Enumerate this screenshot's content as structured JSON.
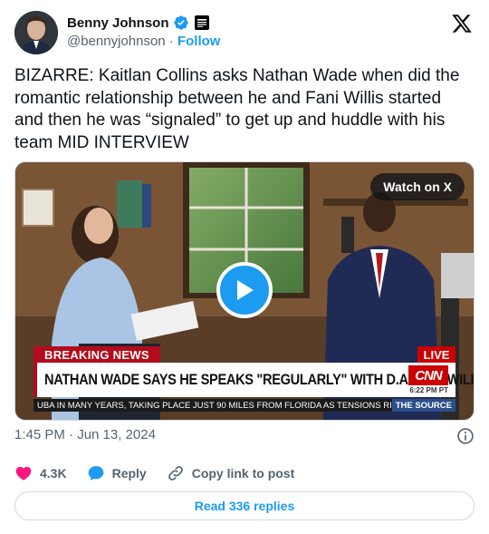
{
  "author": {
    "display_name": "Benny Johnson",
    "handle": "@bennyjohnson",
    "separator": "·",
    "follow_label": "Follow",
    "verified_color": "#1d9bf0",
    "avatar_icon": "person-avatar"
  },
  "tweet": {
    "text": "BIZARRE: Kaitlan Collins asks Nathan Wade when did the romantic relationship between he and Fani Willis started and then he was “signaled” to get up and huddle with his team MID INTERVIEW"
  },
  "media": {
    "watch_label": "Watch on X",
    "breaking_label": "BREAKING NEWS",
    "live_label": "LIVE",
    "headline": "NATHAN WADE SAYS HE SPEAKS \"REGULARLY\" WITH D.A. FANI WILLIS",
    "network_logo": "CNN",
    "network_time": "6:22 PM PT",
    "ticker_text": "UBA IN MANY YEARS, TAKING PLACE JUST 90 MILES FROM FLORIDA AS TENSIONS RISE B",
    "ticker_source": "THE SOURCE"
  },
  "meta": {
    "timestamp": "1:45 PM · Jun 13, 2024"
  },
  "actions": {
    "likes": "4.3K",
    "reply_label": "Reply",
    "copy_label": "Copy link to post"
  },
  "footer": {
    "read_replies_label": "Read 336 replies"
  },
  "colors": {
    "accent": "#1d9bf0",
    "like": "#f91880",
    "breaking_red": "#b30c1c"
  }
}
